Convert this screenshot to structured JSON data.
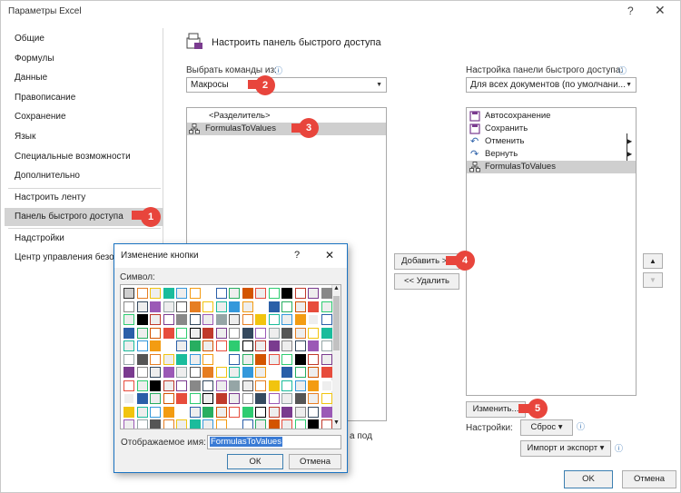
{
  "window": {
    "title": "Параметры Excel",
    "help": "?",
    "close": "✕"
  },
  "sidebar": {
    "items": [
      {
        "label": "Общие",
        "selected": false
      },
      {
        "label": "Формулы",
        "selected": false
      },
      {
        "label": "Данные",
        "selected": false
      },
      {
        "label": "Правописание",
        "selected": false
      },
      {
        "label": "Сохранение",
        "selected": false
      },
      {
        "label": "Язык",
        "selected": false
      },
      {
        "label": "Специальные возможности",
        "selected": false
      },
      {
        "label": "Дополнительно",
        "selected": false
      },
      {
        "label": "Настроить ленту",
        "selected": false
      },
      {
        "label": "Панель быстрого доступа",
        "selected": true
      },
      {
        "label": "Надстройки",
        "selected": false
      },
      {
        "label": "Центр управления безо",
        "selected": false
      }
    ]
  },
  "main": {
    "heading": "Настроить панель быстрого доступа",
    "choose_label": "Выбрать команды из:",
    "choose_value": "Макросы",
    "customize_label": "Настройка панели быстрого доступа:",
    "customize_value": "Для всех документов (по умолчани...",
    "left_list": [
      {
        "label": "<Разделитель>",
        "selected": false,
        "icon": ""
      },
      {
        "label": "FormulasToValues",
        "selected": true,
        "icon": "macro-icon"
      }
    ],
    "right_list": [
      {
        "label": "Автосохранение",
        "icon": "save-icon",
        "selected": false
      },
      {
        "label": "Сохранить",
        "icon": "save-icon",
        "selected": false
      },
      {
        "label": "Отменить",
        "icon": "undo-icon",
        "selected": false
      },
      {
        "label": "Вернуть",
        "icon": "redo-icon",
        "selected": false
      },
      {
        "label": "FormulasToValues",
        "icon": "macro-icon",
        "selected": true
      }
    ],
    "add_button": "Добавить >>",
    "remove_button": "<< Удалить",
    "modify_button": "Изменить...",
    "settings_label": "Настройки:",
    "reset_button": "Сброс ▾",
    "import_export_button": "Импорт и экспорт ▾",
    "partial_text": "а под",
    "ok": "OK",
    "cancel": "Отмена"
  },
  "badges": [
    "1",
    "2",
    "3",
    "4",
    "5"
  ],
  "dialog": {
    "title": "Изменение кнопки",
    "help": "?",
    "close": "✕",
    "symbol_label": "Символ:",
    "display_name_label": "Отображаемое имя:",
    "display_name_value": "FormulasToValues",
    "ok": "ОК",
    "cancel": "Отмена"
  },
  "colors": {
    "badge": "#e8453c",
    "selection": "#cfcfcf",
    "dialog_border": "#1a73c2"
  }
}
